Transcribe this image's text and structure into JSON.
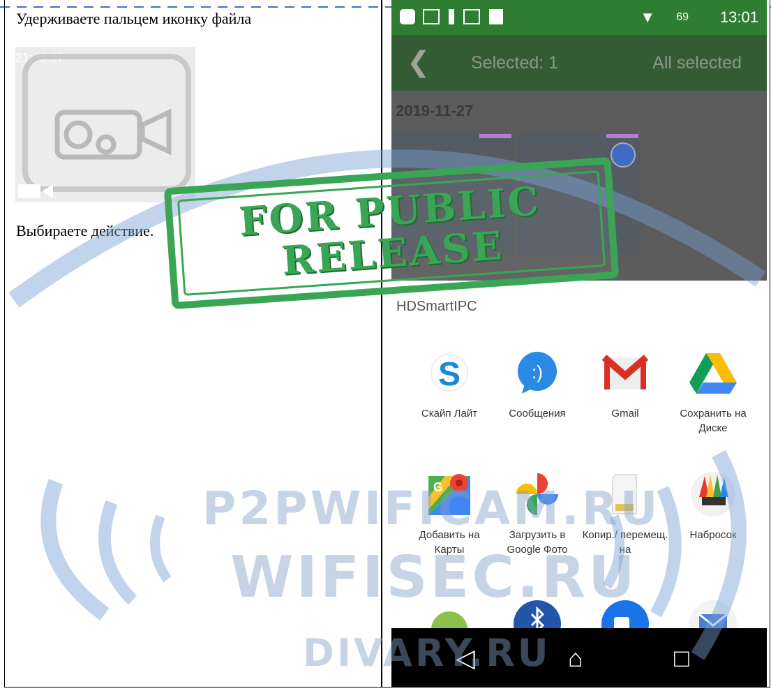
{
  "left": {
    "instruction_1": "Удерживаете пальцем иконку файла",
    "instruction_2": "Выбираете действие.",
    "thumbnail": {
      "time": "21:43:37",
      "duration": "4:55"
    }
  },
  "phone": {
    "status_bar": {
      "clock": "13:01",
      "battery": "69"
    },
    "app_bar": {
      "selected": "Selected: 1",
      "all_selected": "All selected"
    },
    "gallery": {
      "date": "2019-11-27"
    },
    "share": {
      "title": "HDSmartIPC",
      "apps": [
        {
          "label": "Скайп Лайт",
          "icon": "skype-icon"
        },
        {
          "label": "Сообщения",
          "icon": "messages-icon"
        },
        {
          "label": "Gmail",
          "icon": "gmail-icon"
        },
        {
          "label": "Сохранить на Диске",
          "icon": "google-drive-icon"
        },
        {
          "label": "Добавить на Карты",
          "icon": "google-maps-icon"
        },
        {
          "label": "Загрузить в Google Фото",
          "icon": "google-photos-icon"
        },
        {
          "label": "Копир./ перемещ. на",
          "icon": "sd-card-icon"
        },
        {
          "label": "Набросок",
          "icon": "sketch-icon"
        }
      ]
    }
  },
  "watermarks": {
    "stamp_line_1": "FOR PUBLIC",
    "stamp_line_2": "RELEASE",
    "site_1": "P2PWIFICAM.RU",
    "site_2": "WIFISEC.RU",
    "site_3": "DIVARY.RU"
  },
  "colors": {
    "app_bar": "#335c35",
    "stamp": "#3aa655",
    "watermark": "#8aa6cc"
  }
}
